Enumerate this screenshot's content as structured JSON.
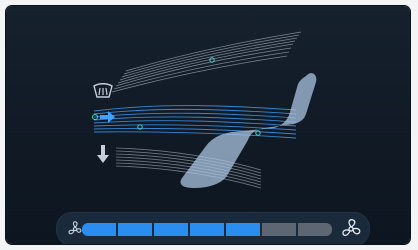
{
  "climate": {
    "modes": [
      {
        "name": "windshield-defrost",
        "active": false,
        "icon": "defrost-icon"
      },
      {
        "name": "face",
        "active": true,
        "icon": "arrow-right-icon"
      },
      {
        "name": "feet",
        "active": false,
        "icon": "arrow-down-icon"
      }
    ],
    "fan": {
      "level": 5,
      "max": 7,
      "low_icon": "fan-small-icon",
      "high_icon": "fan-large-icon"
    }
  },
  "colors": {
    "accent": "#2a8ef0",
    "inactive_segment": "#5c6773",
    "airflow_active": "#3fa3ff",
    "airflow_inactive": "#cfd8e3",
    "seat": "#a9c3e0"
  }
}
